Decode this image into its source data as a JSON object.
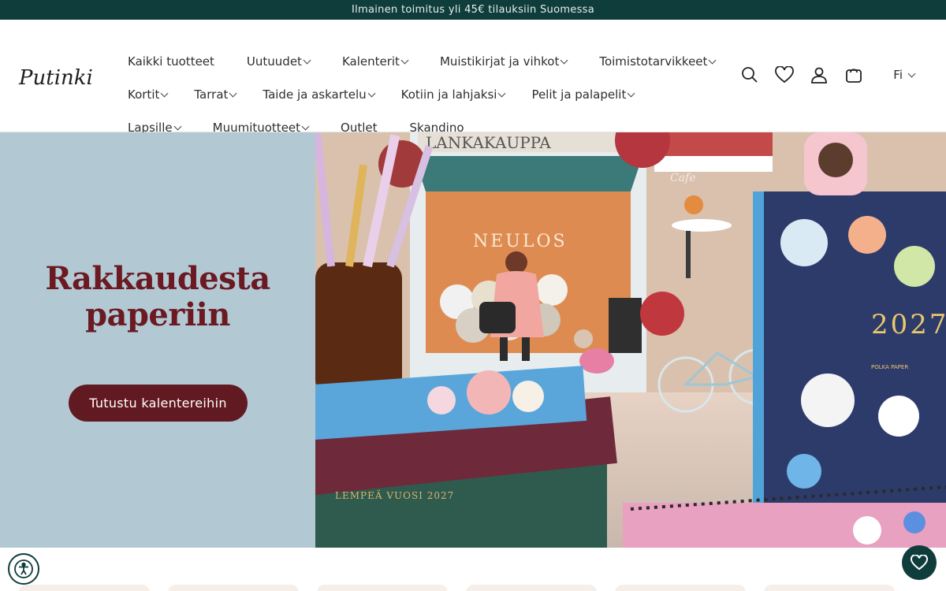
{
  "announcement": "Ilmainen toimitus yli 45€ tilauksiin Suomessa",
  "brand": {
    "name": "Putinki"
  },
  "nav": {
    "row1": [
      {
        "label": "Kaikki tuotteet",
        "dropdown": false
      },
      {
        "label": "Uutuudet",
        "dropdown": true
      },
      {
        "label": "Kalenterit",
        "dropdown": true
      },
      {
        "label": "Muistikirjat ja vihkot",
        "dropdown": true
      },
      {
        "label": "Toimistotarvikkeet",
        "dropdown": true
      }
    ],
    "row2": [
      {
        "label": "Kortit",
        "dropdown": true
      },
      {
        "label": "Tarrat",
        "dropdown": true
      },
      {
        "label": "Taide ja askartelu",
        "dropdown": true
      },
      {
        "label": "Kotiin ja lahjaksi",
        "dropdown": true
      },
      {
        "label": "Pelit ja palapelit",
        "dropdown": true
      }
    ],
    "row3": [
      {
        "label": "Lapsille",
        "dropdown": true
      },
      {
        "label": "Muumituotteet",
        "dropdown": true
      },
      {
        "label": "Outlet",
        "dropdown": false
      },
      {
        "label": "Skandino",
        "dropdown": false
      }
    ]
  },
  "header_icons": [
    "search-icon",
    "heart-icon",
    "account-icon",
    "cart-icon"
  ],
  "language": "Fi",
  "hero": {
    "title_line1": "Rakkaudesta",
    "title_line2": "paperiin",
    "cta": "Tutustu kalentereihin",
    "image_text": {
      "shop_sign": "NEULOS",
      "cafe": "Cafe",
      "planner_year": "2027",
      "planner_brand": "POLKA PAPER",
      "book_title": "LEMPEÄ VUOSI 2027"
    }
  },
  "colors": {
    "announce_bg": "#0e3d3b",
    "hero_bg": "#b2c9d4",
    "title": "#6b1a22",
    "cta_bg": "#621a22"
  }
}
